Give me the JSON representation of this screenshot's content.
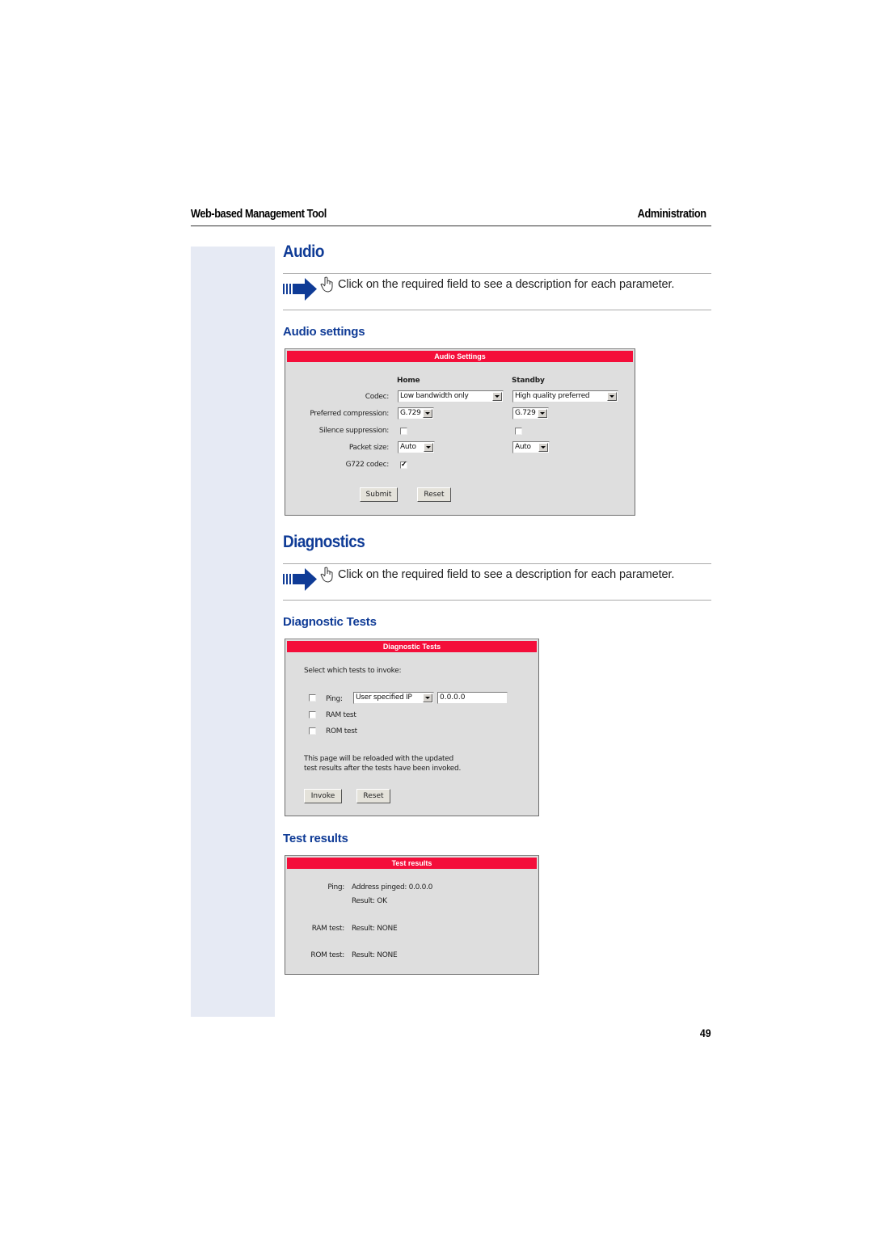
{
  "header": {
    "left": "Web-based Management Tool",
    "right": "Administration"
  },
  "audio": {
    "title": "Audio",
    "note": {
      "icon_arrow": "arrow-right-icon",
      "icon_hand": "hand-pointer-icon",
      "text": "Click on the required field to see a description for each parameter."
    },
    "subtitle": "Audio settings",
    "panel": {
      "title": "Audio Settings",
      "col_home": "Home",
      "col_standby": "Standby",
      "rows": {
        "codec": {
          "label": "Codec:",
          "home": "Low bandwidth only",
          "standby": "High quality preferred"
        },
        "preferred_compression": {
          "label": "Preferred compression:",
          "home": "G.729",
          "standby": "G.729"
        },
        "silence_suppression": {
          "label": "Silence suppression:",
          "home_checked": false,
          "standby_checked": false
        },
        "packet_size": {
          "label": "Packet size:",
          "home": "Auto",
          "standby": "Auto"
        },
        "g722_codec": {
          "label": "G722 codec:",
          "home_checked": true
        }
      },
      "submit_label": "Submit",
      "reset_label": "Reset"
    }
  },
  "diagnostics": {
    "title": "Diagnostics",
    "note": {
      "icon_arrow": "arrow-right-icon",
      "icon_hand": "hand-pointer-icon",
      "text": "Click on the required field to see a description for each parameter."
    },
    "tests_subtitle": "Diagnostic Tests",
    "tests_panel": {
      "title": "Diagnostic Tests",
      "intro": "Select which tests to invoke:",
      "ping": {
        "label": "Ping:",
        "checked": false,
        "mode": "User specified IP",
        "address": "0.0.0.0"
      },
      "ram": {
        "label": "RAM test",
        "checked": false
      },
      "rom": {
        "label": "ROM test",
        "checked": false
      },
      "info_line1": "This page will be reloaded with the updated",
      "info_line2": "test results after the tests have been invoked.",
      "invoke_label": "Invoke",
      "reset_label": "Reset"
    },
    "results_subtitle": "Test results",
    "results_panel": {
      "title": "Test results",
      "ping_label": "Ping:",
      "ping_address": "Address pinged: 0.0.0.0",
      "ping_result": "Result: OK",
      "ram_label": "RAM test:",
      "ram_result": "Result: NONE",
      "rom_label": "ROM test:",
      "rom_result": "Result: NONE"
    }
  },
  "page_number": "49",
  "colors": {
    "heading_blue": "#0f3b96",
    "panel_bar_red": "#f40e3a",
    "panel_bg": "#dedede",
    "side_band": "#e6eaf4"
  }
}
